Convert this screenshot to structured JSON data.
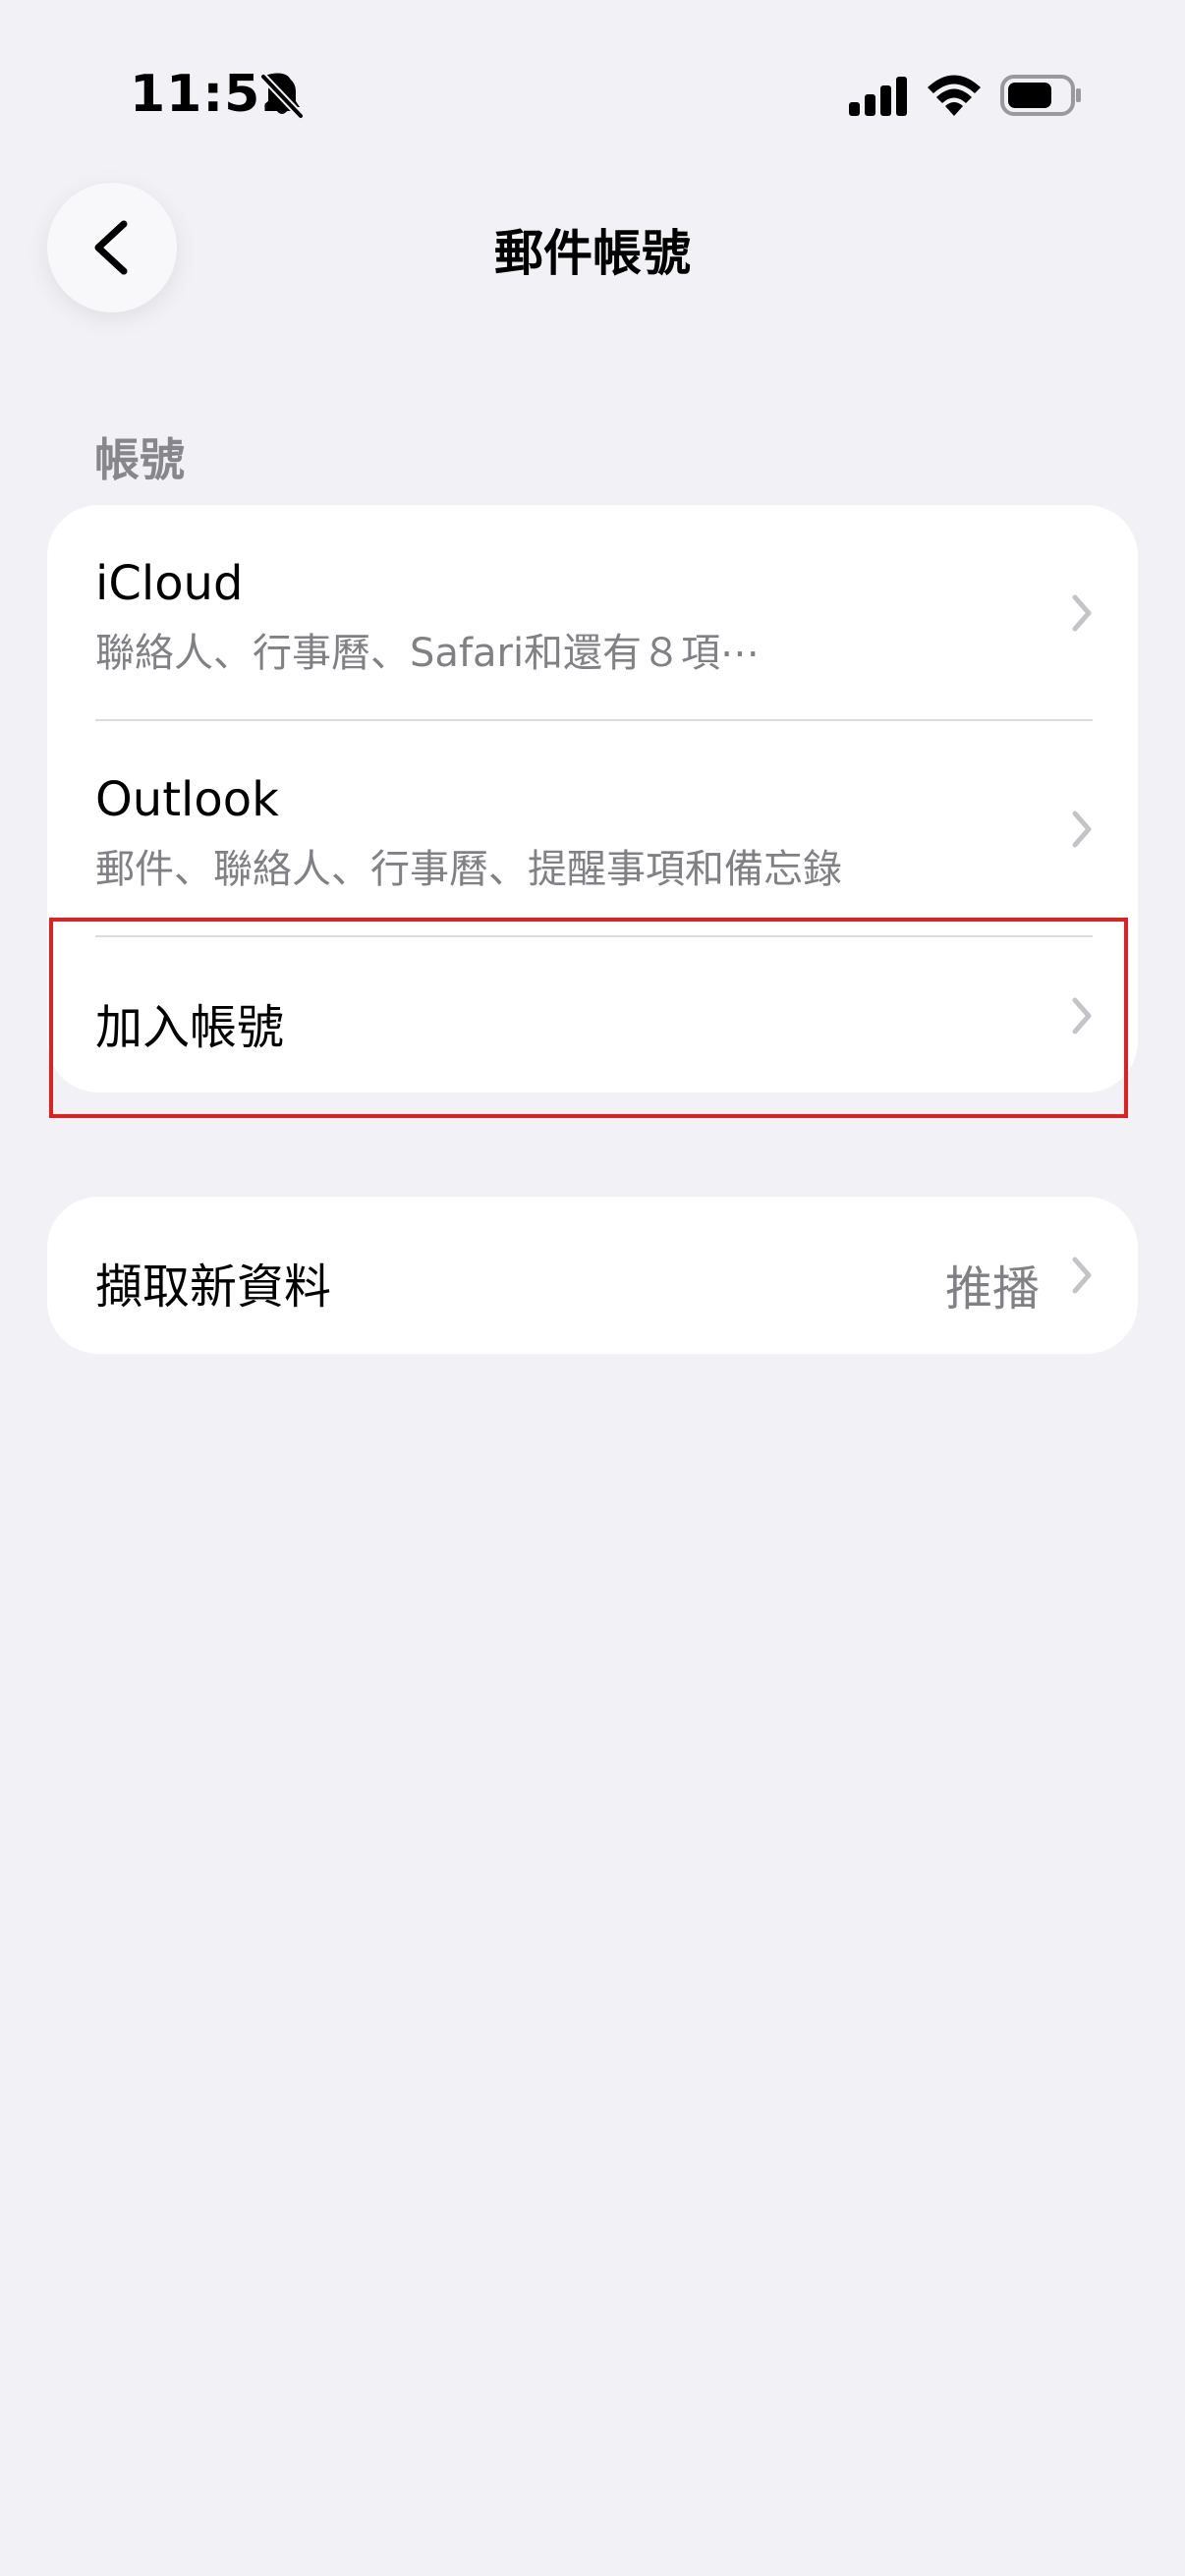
{
  "status_bar": {
    "time": "11:52",
    "icons": [
      "bell-slash-icon",
      "cellular-signal-icon",
      "wifi-icon",
      "battery-icon"
    ]
  },
  "nav": {
    "back_icon": "chevron-left-icon",
    "title": "郵件帳號"
  },
  "accounts_section": {
    "header": "帳號",
    "items": [
      {
        "title": "iCloud",
        "subtitle": "聯絡人、行事曆、Safari和還有８項⋯"
      },
      {
        "title": "Outlook",
        "subtitle": "郵件、聯絡人、行事曆、提醒事項和備忘錄"
      },
      {
        "title": "加入帳號"
      }
    ]
  },
  "fetch_section": {
    "title": "擷取新資料",
    "value": "推播"
  },
  "colors": {
    "background": "#f1f1f6",
    "highlight": "#e02020",
    "secondary_text": "#808085",
    "chevron": "#c4c4c8"
  }
}
